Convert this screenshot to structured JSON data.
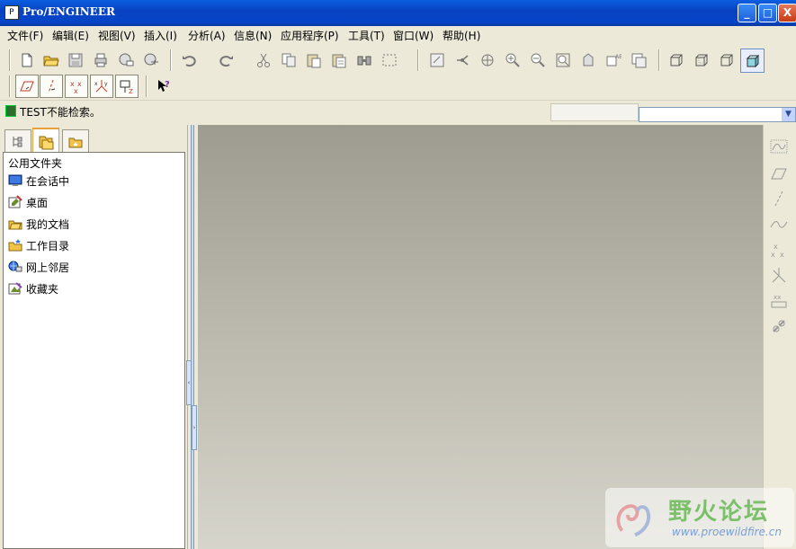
{
  "window": {
    "title": "Pro/ENGINEER",
    "icon": "proe-app-icon",
    "min_label": "_",
    "max_label": "□",
    "close_label": "X"
  },
  "menu": [
    {
      "label": "文件(F)"
    },
    {
      "label": "编辑(E)"
    },
    {
      "label": "视图(V)"
    },
    {
      "label": "插入(I)"
    },
    {
      "label": "分析(A)"
    },
    {
      "label": "信息(N)"
    },
    {
      "label": "应用程序(P)"
    },
    {
      "label": "工具(T)"
    },
    {
      "label": "窗口(W)"
    },
    {
      "label": "帮助(H)"
    }
  ],
  "status": {
    "message": "TEST不能检索。"
  },
  "navigator": {
    "tabs": [
      "model-tree-icon",
      "folder-browser-icon",
      "favorites-icon"
    ],
    "header": "公用文件夹",
    "items": [
      {
        "label": "在会话中",
        "icon": "in-session-icon"
      },
      {
        "label": "桌面",
        "icon": "desktop-icon"
      },
      {
        "label": "我的文档",
        "icon": "my-documents-icon"
      },
      {
        "label": "工作目录",
        "icon": "working-directory-icon"
      },
      {
        "label": "网上邻居",
        "icon": "network-places-icon"
      },
      {
        "label": "收藏夹",
        "icon": "favorites-folder-icon"
      }
    ]
  },
  "watermark": {
    "title": "野火论坛",
    "url": "www.proewildfire.cn"
  },
  "colors": {
    "title_bar": "#0842c2",
    "viewport_top": "#9e9b90",
    "viewport_bottom": "#d6d5cb",
    "chrome": "#ece9d8"
  }
}
